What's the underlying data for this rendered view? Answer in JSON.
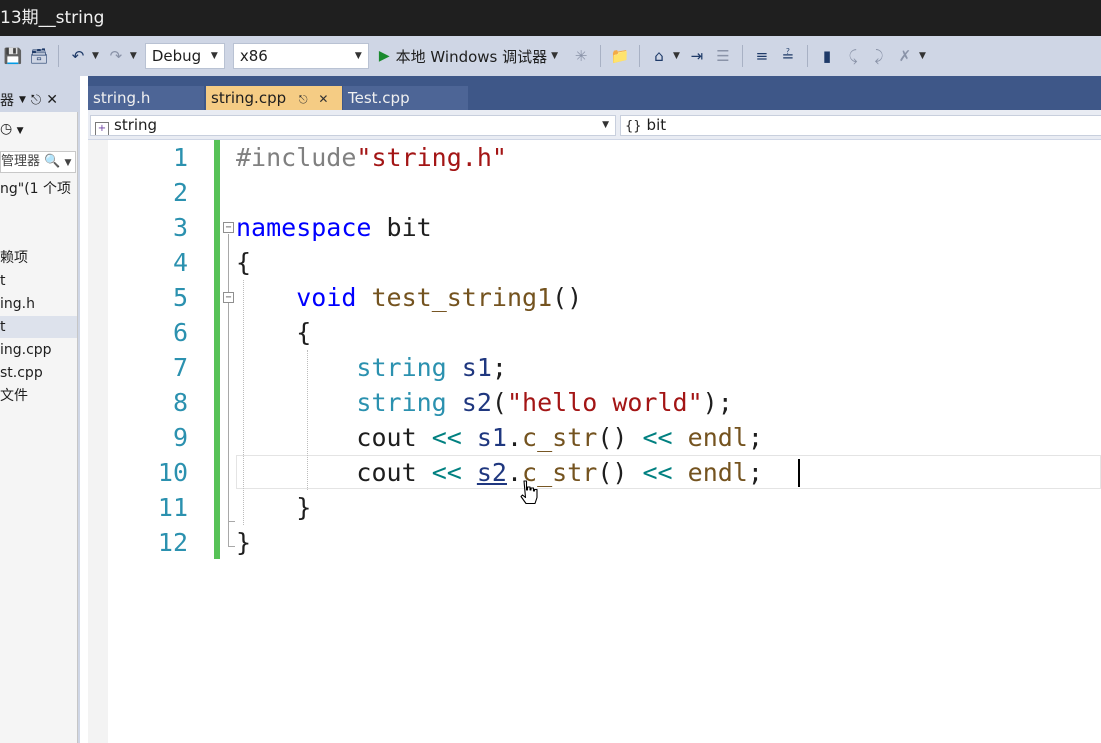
{
  "window": {
    "title": "13期__string"
  },
  "toolbar": {
    "config": "Debug",
    "platform": "x86",
    "run_label": "本地 Windows 调试器"
  },
  "solution_explorer": {
    "header_label": "器",
    "search_placeholder": "管理器",
    "items": [
      "ng\"(1 个项",
      "赖项",
      "t",
      "ing.h",
      "t",
      "ing.cpp",
      "st.cpp",
      "文件"
    ]
  },
  "tabs": [
    {
      "label": "string.h",
      "active": false
    },
    {
      "label": "string.cpp",
      "active": true
    },
    {
      "label": "Test.cpp",
      "active": false
    }
  ],
  "navbar": {
    "scope": "string",
    "member": "bit"
  },
  "editor": {
    "line_numbers": [
      "1",
      "2",
      "3",
      "4",
      "5",
      "6",
      "7",
      "8",
      "9",
      "10",
      "11",
      "12"
    ],
    "code": {
      "l1_pp": "#include",
      "l1_str": "\"string.h\"",
      "l3_kw": "namespace",
      "l3_name": " bit",
      "l4": "{",
      "l5_kw": "void",
      "l5_fn": "test_string1",
      "l5_rest": "()",
      "l6": "{",
      "l7_ty": "string",
      "l7_var": "s1",
      "l7_end": ";",
      "l8_ty": "string",
      "l8_var": "s2",
      "l8_open": "(",
      "l8_str": "\"hello world\"",
      "l8_close": ");",
      "l9_cout": "cout",
      "l9_op1": "<<",
      "l9_var": "s1",
      "l9_dot": ".",
      "l9_fn": "c_str",
      "l9_paren": "()",
      "l9_op2": "<<",
      "l9_endl": "endl",
      "l9_end": ";",
      "l10_cout": "cout",
      "l10_op1": "<<",
      "l10_var": "s2",
      "l10_dot": ".",
      "l10_fn": "c_str",
      "l10_paren": "()",
      "l10_op2": "<<",
      "l10_endl": "endl",
      "l10_end": ";",
      "l11": "}",
      "l12": "}"
    }
  },
  "colors": {
    "keyword": "#0000ff",
    "type": "#2b91af",
    "function": "#74531f",
    "string": "#a31515",
    "variable": "#1f377f",
    "operator": "#008080",
    "line_number": "#2b91af",
    "active_tab": "#f5cc84",
    "tab_strip": "#3e5788",
    "change_bar": "#57c257"
  }
}
